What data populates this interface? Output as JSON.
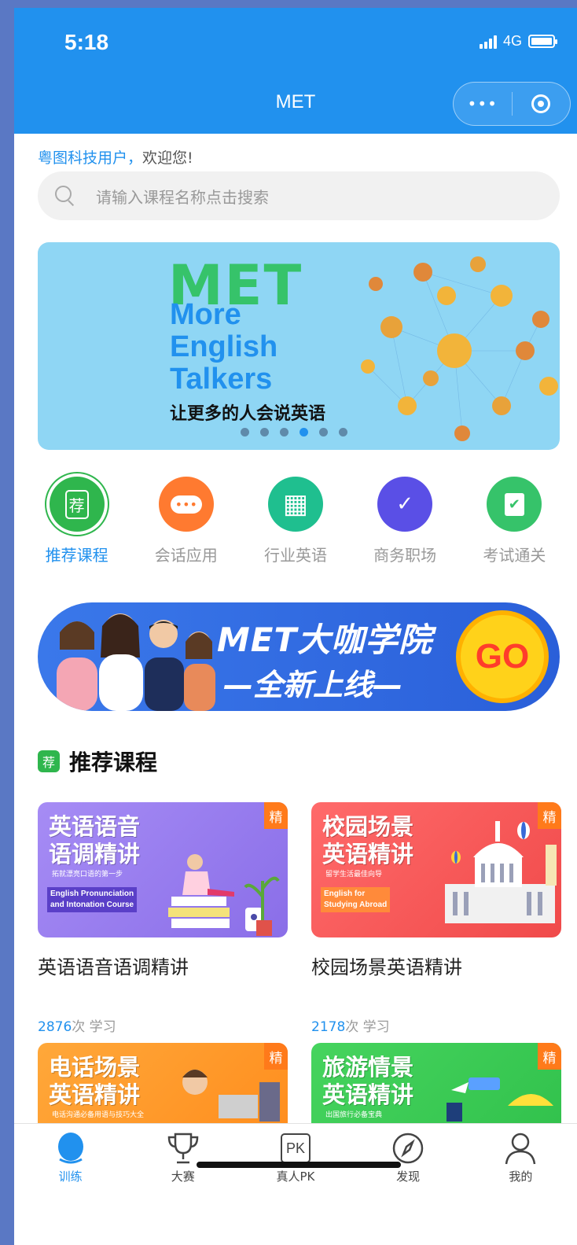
{
  "status": {
    "time": "5:18",
    "network": "4G"
  },
  "nav": {
    "title": "MET",
    "menu_label": "•••"
  },
  "welcome": {
    "user": "粤图科技用户",
    "comma": "，",
    "greeting": "欢迎您!"
  },
  "search": {
    "placeholder": "请输入课程名称点击搜索"
  },
  "banner": {
    "brand": "MET",
    "line1": "More",
    "line2": "English",
    "line3": "Talkers",
    "subtitle": "让更多的人会说英语",
    "slide_count": 6,
    "active_slide": 4
  },
  "categories": [
    {
      "label": "推荐课程",
      "icon": "recommend-icon",
      "color": "#2fb64d",
      "active": true,
      "glyph": "荐"
    },
    {
      "label": "会话应用",
      "icon": "chat-icon",
      "color": "#ff7a30",
      "active": false,
      "glyph": "•••"
    },
    {
      "label": "行业英语",
      "icon": "grid-icon",
      "color": "#1fbf8f",
      "active": false,
      "glyph": "▦"
    },
    {
      "label": "商务职场",
      "icon": "business-icon",
      "color": "#5a4fe6",
      "active": false,
      "glyph": "✓"
    },
    {
      "label": "考试通关",
      "icon": "exam-icon",
      "color": "#36c36a",
      "active": false,
      "glyph": "✔"
    }
  ],
  "promo": {
    "title": "MET大咖学院",
    "subtitle": "—全新上线—",
    "go": "GO"
  },
  "section": {
    "badge": "荐",
    "title": "推荐课程"
  },
  "courses": [
    {
      "badge": "精",
      "thumb_title_1": "英语语音",
      "thumb_title_2": "语调精讲",
      "thumb_sub": "拓就漂亮口语的第一步",
      "thumb_en_1": "English Pronunciation",
      "thumb_en_2": "and Intonation Course",
      "name": "英语语音语调精讲",
      "count": "2876",
      "count_suffix": "次 学习",
      "bg": "#9a7ef0",
      "tag_bg": "#5a3fc8"
    },
    {
      "badge": "精",
      "thumb_title_1": "校园场景",
      "thumb_title_2": "英语精讲",
      "thumb_sub": "留学生活最佳向导",
      "thumb_en_1": "English for",
      "thumb_en_2": "Studying Abroad",
      "name": "校园场景英语精讲",
      "count": "2178",
      "count_suffix": "次 学习",
      "bg": "#ff5a5a",
      "tag_bg": "#ff8a3a"
    },
    {
      "badge": "精",
      "thumb_title_1": "电话场景",
      "thumb_title_2": "英语精讲",
      "thumb_sub": "电话沟通必备用语与技巧大全",
      "bg": "#ff9a2a"
    },
    {
      "badge": "精",
      "thumb_title_1": "旅游情景",
      "thumb_title_2": "英语精讲",
      "thumb_sub": "出国旅行必备宝典",
      "bg": "#3ccf5a"
    }
  ],
  "tabbar": [
    {
      "label": "训练",
      "icon": "train-icon",
      "active": true
    },
    {
      "label": "大赛",
      "icon": "trophy-icon",
      "active": false
    },
    {
      "label": "真人PK",
      "icon": "pk-icon",
      "active": false
    },
    {
      "label": "发现",
      "icon": "compass-icon",
      "active": false
    },
    {
      "label": "我的",
      "icon": "profile-icon",
      "active": false
    }
  ],
  "colors": {
    "primary": "#2191ee",
    "accent_orange": "#ff7a1a",
    "green": "#2fb64d"
  }
}
